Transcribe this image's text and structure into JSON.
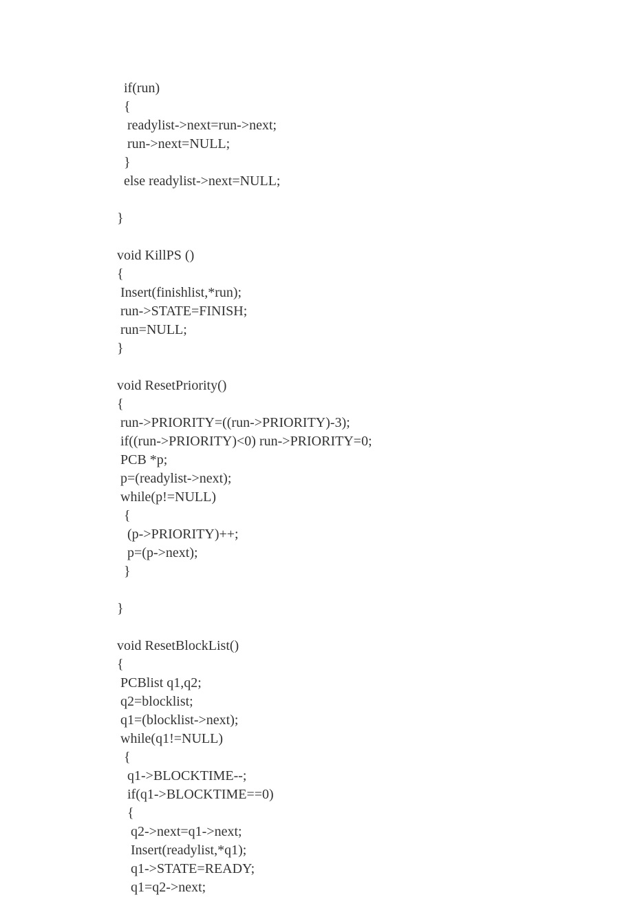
{
  "code": {
    "lines": [
      "  if(run)",
      "  {",
      "   readylist->next=run->next;",
      "   run->next=NULL;",
      "  }",
      "  else readylist->next=NULL;",
      "",
      "}",
      "",
      "void KillPS ()",
      "{",
      " Insert(finishlist,*run);",
      " run->STATE=FINISH;",
      " run=NULL;",
      "}",
      "",
      "void ResetPriority()",
      "{",
      " run->PRIORITY=((run->PRIORITY)-3);",
      " if((run->PRIORITY)<0) run->PRIORITY=0;",
      " PCB *p;",
      " p=(readylist->next);",
      " while(p!=NULL)",
      "  {",
      "   (p->PRIORITY)++;",
      "   p=(p->next);",
      "  }",
      "",
      "}",
      "",
      "void ResetBlockList()",
      "{",
      " PCBlist q1,q2;",
      " q2=blocklist;",
      " q1=(blocklist->next);",
      " while(q1!=NULL)",
      "  {",
      "   q1->BLOCKTIME--;",
      "   if(q1->BLOCKTIME==0)",
      "   {",
      "    q2->next=q1->next;",
      "    Insert(readylist,*q1);",
      "    q1->STATE=READY;",
      "    q1=q2->next;"
    ]
  }
}
